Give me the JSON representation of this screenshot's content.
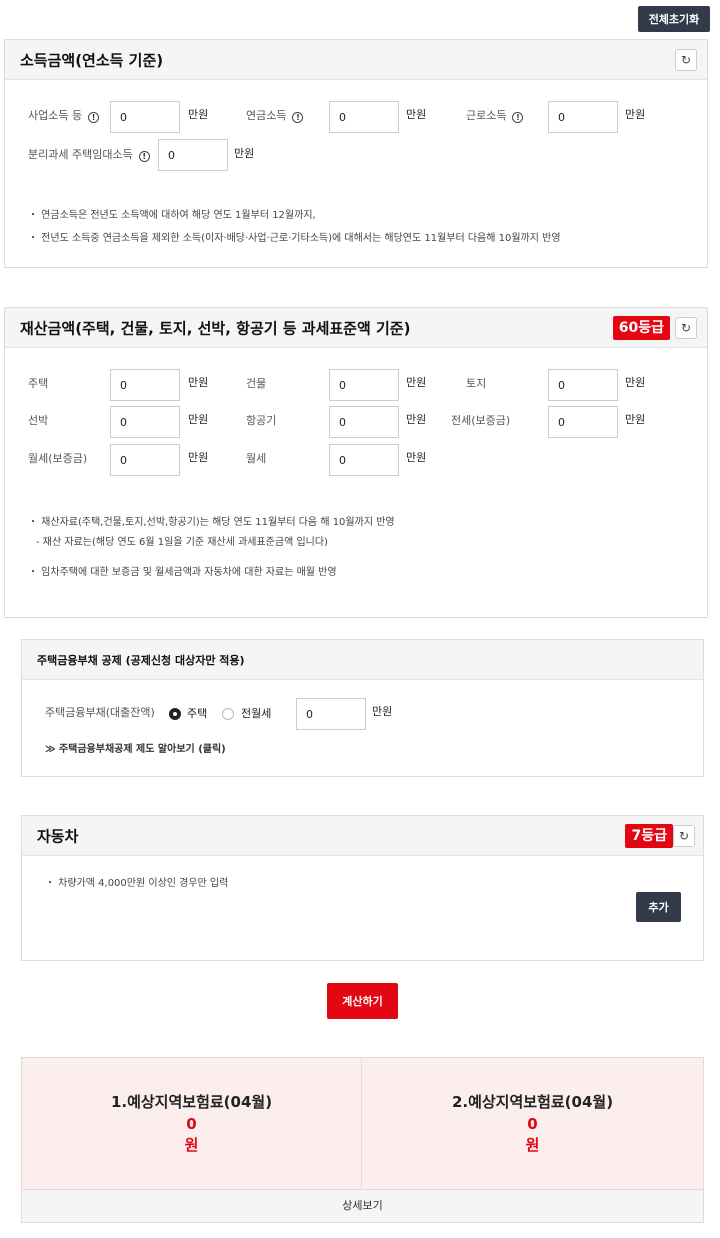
{
  "top": {
    "reset_all": "전체초기화"
  },
  "income": {
    "title": "소득금액(연소득 기준)",
    "refresh": "↻",
    "fields": [
      {
        "label": "사업소득 등",
        "value": "0",
        "unit": "만원",
        "info": "!"
      },
      {
        "label": "연금소득",
        "value": "0",
        "unit": "만원",
        "info": "!"
      },
      {
        "label": "근로소득",
        "value": "0",
        "unit": "만원",
        "info": "!"
      },
      {
        "label": "분리과세 주택임대소득",
        "value": "0",
        "unit": "만원",
        "info": "!"
      }
    ],
    "notes": [
      "・ 연금소득은 전년도 소득액에 대하여 해당 연도 1월부터 12월까지,",
      "・ 전년도 소득중 연금소득을 제외한 소득(이자·배당·사업·근로·기타소득)에 대해서는 해당연도 11월부터 다음해 10월까지 반영"
    ]
  },
  "property": {
    "title": "재산금액(주택, 건물, 토지, 선박, 항공기 등 과세표준액 기준)",
    "grade": "60등급",
    "refresh": "↻",
    "fields": [
      {
        "label": "주택",
        "value": "0",
        "unit": "만원"
      },
      {
        "label": "건물",
        "value": "0",
        "unit": "만원"
      },
      {
        "label": "토지",
        "value": "0",
        "unit": "만원"
      },
      {
        "label": "선박",
        "value": "0",
        "unit": "만원"
      },
      {
        "label": "항공기",
        "value": "0",
        "unit": "만원"
      },
      {
        "label": "전세(보증금)",
        "value": "0",
        "unit": "만원"
      },
      {
        "label": "월세(보증금)",
        "value": "0",
        "unit": "만원"
      },
      {
        "label": "월세",
        "value": "0",
        "unit": "만원"
      }
    ],
    "notes": [
      "・ 재산자료(주택,건물,토지,선박,항공기)는 해당 연도 11월부터 다음 해 10월까지 반영",
      "- 재산 자료는(해당 연도 6월 1일을 기준 재산세 과세표준금액 입니다)",
      "・ 임차주택에 대한 보증금 및 월세금액과 자동차에 대한 자료는 매월 반영"
    ]
  },
  "debt": {
    "title": "주택금융부채 공제 (공제신청 대상자만 적용)",
    "label": "주택금융부채(대출잔액)",
    "option1": "주택",
    "option2": "전월세",
    "value": "0",
    "unit": "만원",
    "link": "≫ 주택금융부채공제 제도 알아보기 (클릭)"
  },
  "car": {
    "title": "자동차",
    "grade": "7등급",
    "refresh": "↻",
    "note": "・ 차량가액 4,000만원 이상인 경우만 입력",
    "add": "추가"
  },
  "calculate": "계산하기",
  "results": [
    {
      "title": "1.예상지역보험료(04월)",
      "value": "0",
      "unit": "원"
    },
    {
      "title": "2.예상지역보험료(04월)",
      "value": "0",
      "unit": "원"
    }
  ],
  "detail": "상세보기"
}
